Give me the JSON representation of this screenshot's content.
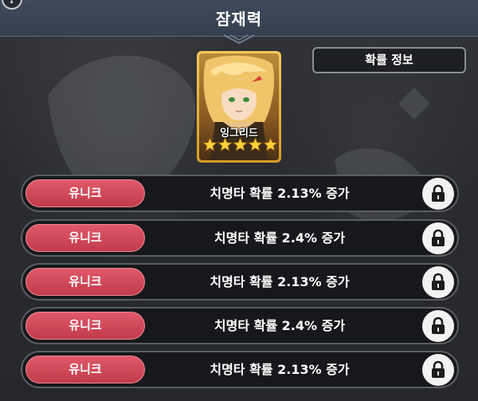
{
  "header": {
    "title": "잠재력",
    "help_icon": "question-mark-icon"
  },
  "probability_button": {
    "label": "확률 정보"
  },
  "character": {
    "name": "잉그리드",
    "star_count": 5,
    "frame_color": "#e8b340"
  },
  "potentials": [
    {
      "grade": "유니크",
      "effect": "치명타 확률 2.13% 증가",
      "locked": true
    },
    {
      "grade": "유니크",
      "effect": "치명타 확률 2.4% 증가",
      "locked": true
    },
    {
      "grade": "유니크",
      "effect": "치명타 확률 2.13% 증가",
      "locked": true
    },
    {
      "grade": "유니크",
      "effect": "치명타 확률 2.4% 증가",
      "locked": true
    },
    {
      "grade": "유니크",
      "effect": "치명타 확률 2.13% 증가",
      "locked": true
    }
  ],
  "colors": {
    "badge": "#d04a5a",
    "row_bg": "#17181b",
    "header_bg": "#3a4656"
  }
}
